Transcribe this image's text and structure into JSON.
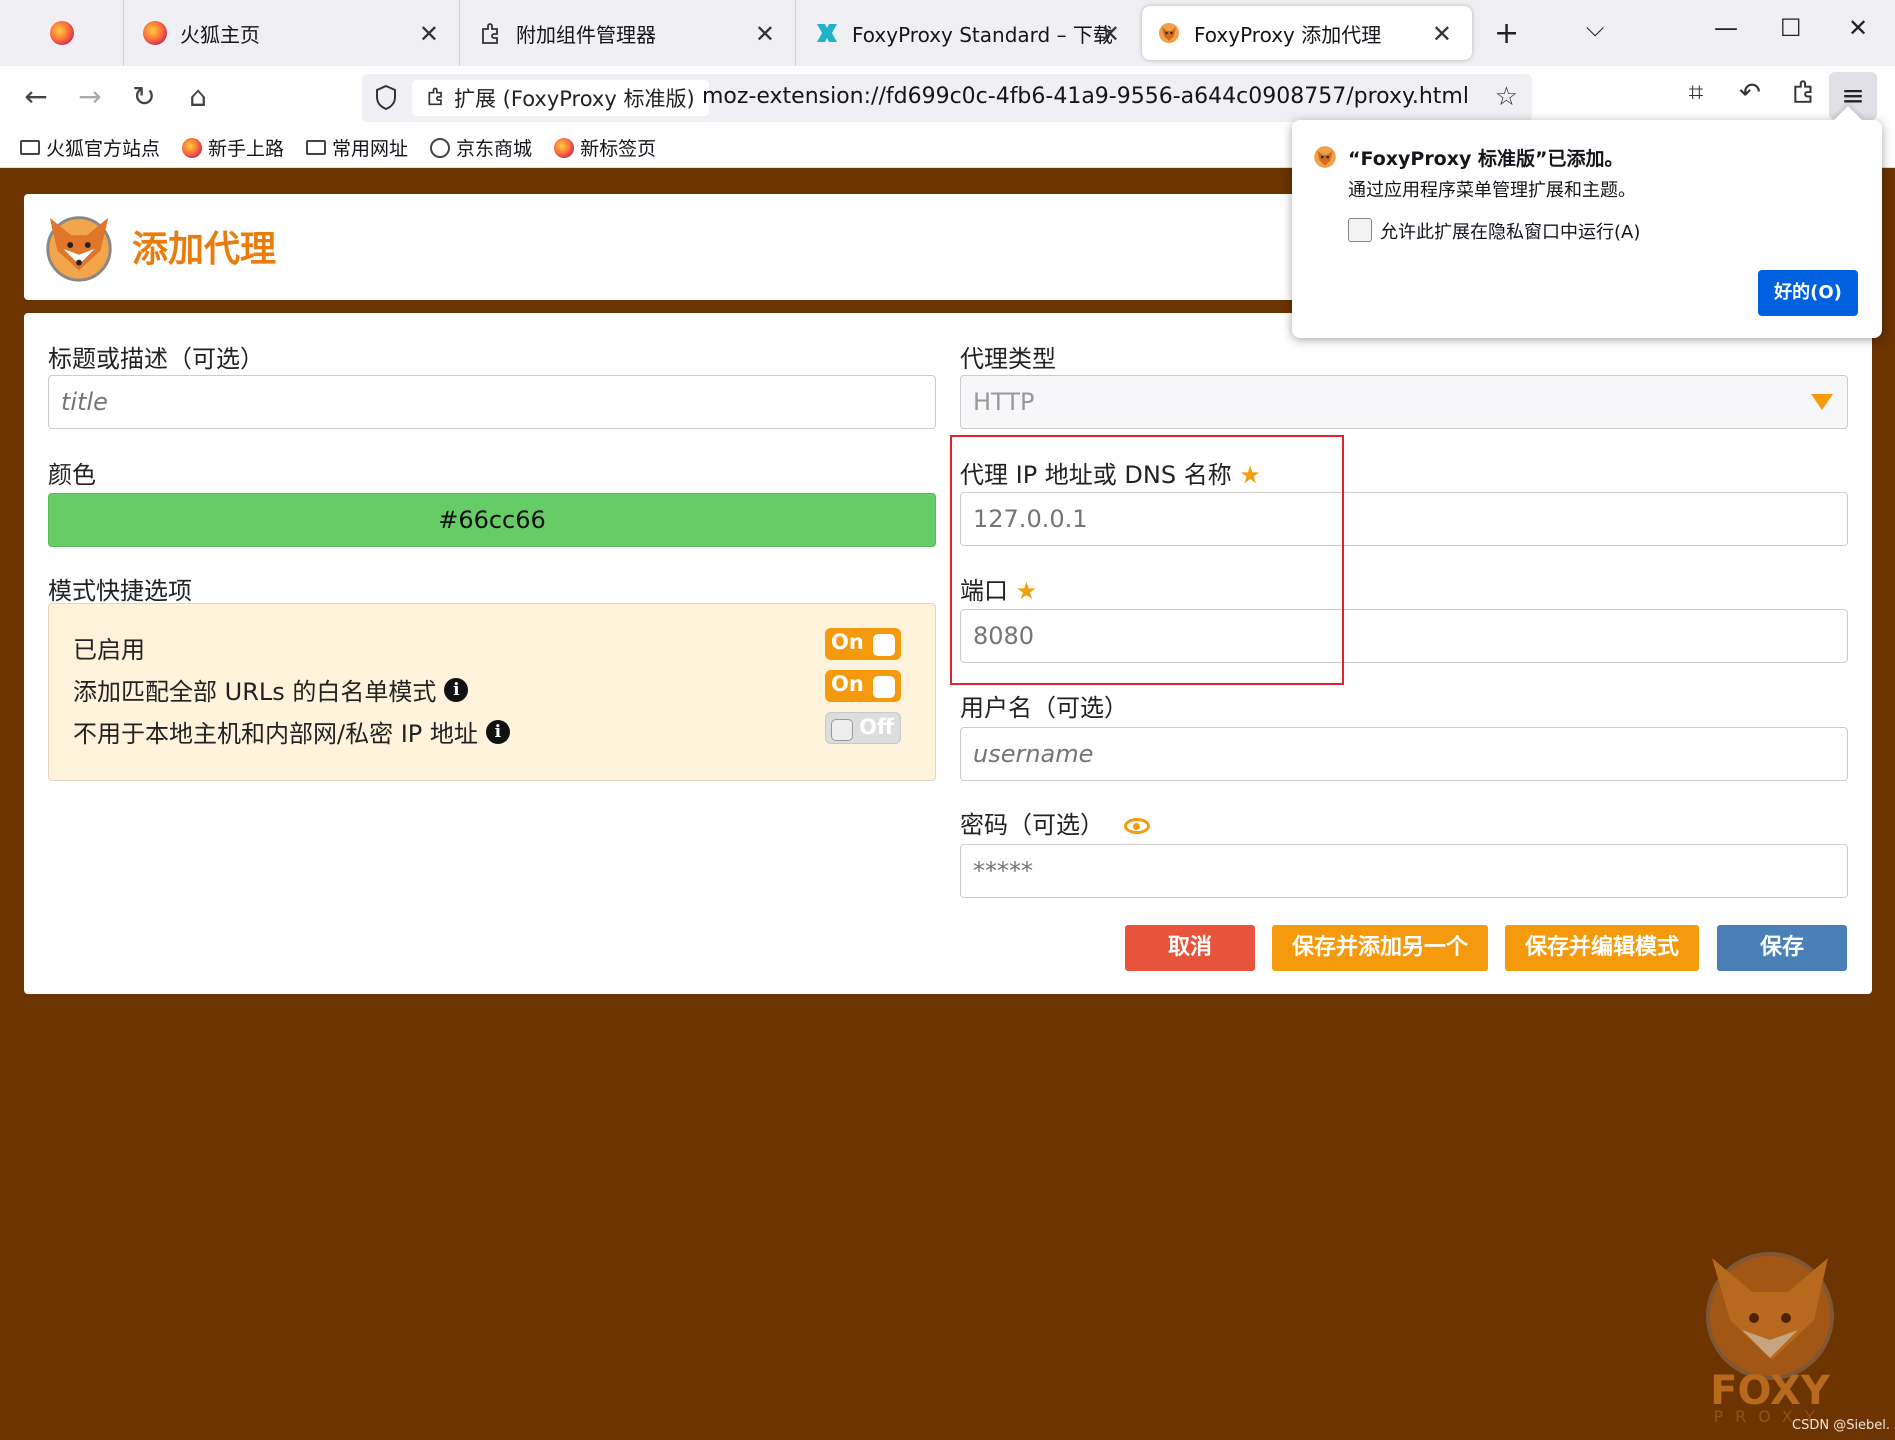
{
  "browser": {
    "tabs": [
      {
        "label": ""
      },
      {
        "label": "火狐主页"
      },
      {
        "label": "附加组件管理器"
      },
      {
        "label": "FoxyProxy Standard – 下载"
      },
      {
        "label": "FoxyProxy 添加代理"
      }
    ],
    "url_identity": "扩展 (FoxyProxy 标准版)",
    "url": "moz-extension://fd699c0c-4fb6-41a9-9556-a644c0908757/proxy.html",
    "bookmarks": [
      {
        "label": "火狐官方站点",
        "icon": "folder-icon"
      },
      {
        "label": "新手上路",
        "icon": "firefox-icon"
      },
      {
        "label": "常用网址",
        "icon": "folder-icon"
      },
      {
        "label": "京东商城",
        "icon": "globe-icon"
      },
      {
        "label": "新标签页",
        "icon": "firefox-icon"
      }
    ]
  },
  "popup": {
    "title": "“FoxyProxy 标准版”已添加。",
    "subtitle": "通过应用程序菜单管理扩展和主题。",
    "checkbox_label": "允许此扩展在隐私窗口中运行(A)",
    "ok_label": "好的(O)"
  },
  "page": {
    "title": "添加代理",
    "title_field": {
      "label": "标题或描述（可选）",
      "placeholder": "title"
    },
    "color_field": {
      "label": "颜色",
      "value": "#66cc66"
    },
    "pattern_shortcuts": {
      "label": "模式快捷选项",
      "rows": [
        {
          "label": "已启用",
          "state": "On"
        },
        {
          "label": "添加匹配全部 URLs 的白名单模式",
          "state": "On"
        },
        {
          "label": "不用于本地主机和内部网/私密 IP 地址",
          "state": "Off"
        }
      ]
    },
    "proxy_type": {
      "label": "代理类型",
      "value": "HTTP"
    },
    "proxy_host": {
      "label": "代理 IP 地址或 DNS 名称",
      "placeholder": "127.0.0.1"
    },
    "port": {
      "label": "端口",
      "placeholder": "8080"
    },
    "username": {
      "label": "用户名（可选）",
      "placeholder": "username"
    },
    "password": {
      "label": "密码（可选）",
      "placeholder": "*****"
    },
    "buttons": {
      "cancel": "取消",
      "save_add_another": "保存并添加另一个",
      "save_edit_patterns": "保存并编辑模式",
      "save": "保存"
    }
  },
  "watermark": {
    "text": "FOXY",
    "sub": "PROXY",
    "credit": "CSDN @Siebel."
  },
  "colors": {
    "brand_orange": "#e87d0d",
    "toggle_orange": "#f59a0c",
    "page_bg": "#6b3400",
    "cancel_red": "#e8533c",
    "save_blue": "#4a80b8",
    "highlight_red": "#e3222f"
  }
}
